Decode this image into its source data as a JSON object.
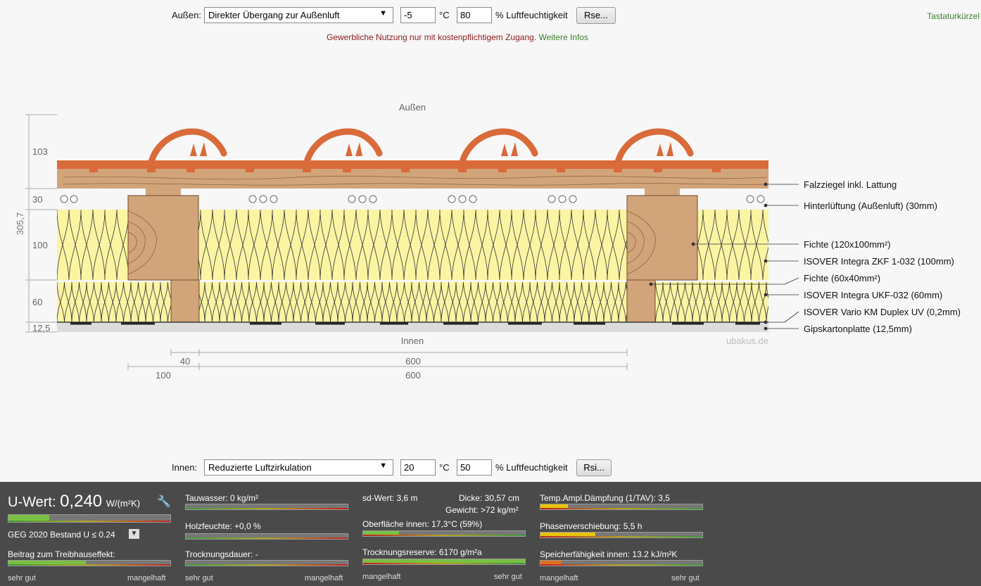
{
  "top": {
    "label": "Außen:",
    "select": "Direkter Übergang zur Außenluft",
    "temp": "-5",
    "temp_unit": "°C",
    "humidity": "80",
    "humidity_unit": "% Luftfeuchtigkeit",
    "button": "Rse...",
    "shortcuts": "Tastaturkürzel"
  },
  "notice": {
    "text": "Gewerbliche Nutzung nur mit kostenpflichtigem Zugang.",
    "link": "Weitere Infos"
  },
  "drawing": {
    "outside": "Außen",
    "inside": "Innen",
    "watermark": "ubakus.de",
    "total": "305,7",
    "dims": [
      "103",
      "30",
      "100",
      "60",
      "12,5"
    ],
    "bottom_dims": [
      "40",
      "600",
      "100",
      "600"
    ],
    "layers": [
      "Falzziegel inkl. Lattung",
      "Hinterlüftung (Außenluft) (30mm)",
      "Fichte (120x100mm²)",
      "ISOVER Integra ZKF 1-032 (100mm)",
      "Fichte (60x40mm²)",
      "ISOVER Integra UKF-032 (60mm)",
      "ISOVER Vario KM Duplex UV (0,2mm)",
      "Gipskartonplatte (12,5mm)"
    ]
  },
  "bottom": {
    "label": "Innen:",
    "select": "Reduzierte Luftzirkulation",
    "temp": "20",
    "temp_unit": "°C",
    "humidity": "50",
    "humidity_unit": "% Luftfeuchtigkeit",
    "button": "Rsi..."
  },
  "results": {
    "uwert_label": "U-Wert:",
    "uwert_value": "0,240",
    "uwert_unit": "W/(m²K)",
    "geg": "GEG 2020 Bestand U ≤ 0.24",
    "treibhaus": "Beitrag zum Treibhauseffekt:",
    "tauwasser": "Tauwasser: 0 kg/m²",
    "holzfeuchte": "Holzfeuchte: +0,0 %",
    "trocknungsdauer": "Trocknungsdauer: -",
    "sd_wert": "sd-Wert: 3,6 m",
    "dicke": "Dicke: 30,57 cm",
    "gewicht": "Gewicht: >72 kg/m²",
    "oberflaeche": "Oberfläche innen: 17,3°C (59%)",
    "trocknungsreserve": "Trocknungsreserve: 6170 g/m²a",
    "tav": "Temp.Ampl.Dämpfung (1/TAV): 3,5",
    "phasen": "Phasenverschiebung: 5,5 h",
    "speicher": "Speicherfähigkeit innen: 13.2 kJ/m²K",
    "scale_good": "sehr gut",
    "scale_bad": "mangelhaft",
    "scale_bad2": "mangelhaft",
    "scale_good2": "sehr gut",
    "levels": {
      "uwert": 0.25,
      "treibhaus": 0.48,
      "tauwasser": 0.0,
      "holzfeuchte": 0.0,
      "trocknungsdauer": 0.0,
      "oberflaeche": 0.22,
      "trocknungsreserve": 1.0,
      "tav": 0.17,
      "phasen": 0.34,
      "speicher": 0.13
    },
    "colors": {
      "good": "#7ac043",
      "mid": "#e8c400",
      "low": "#e07020"
    }
  }
}
